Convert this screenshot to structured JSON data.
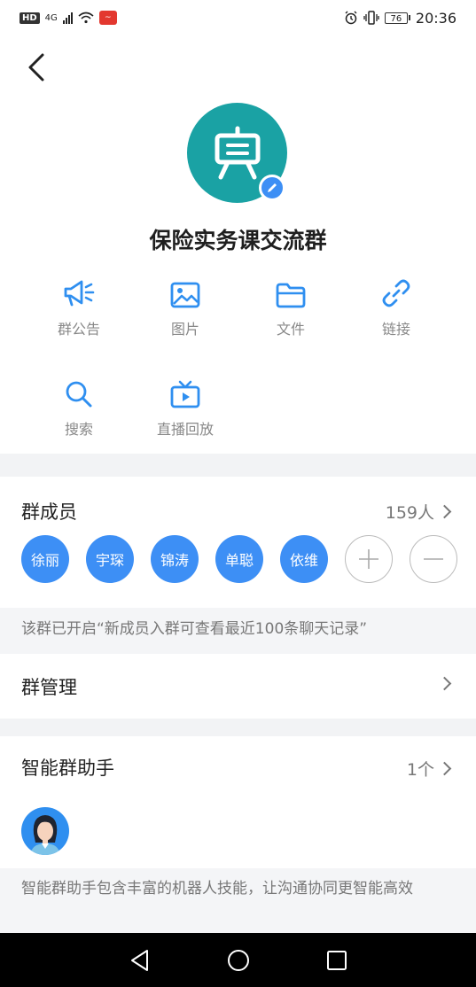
{
  "status_bar": {
    "hd": "HD",
    "network": "4G",
    "battery": "76",
    "time": "20:36"
  },
  "group": {
    "name": "保险实务课交流群"
  },
  "functions": [
    {
      "label": "群公告",
      "icon": "megaphone-icon"
    },
    {
      "label": "图片",
      "icon": "image-icon"
    },
    {
      "label": "文件",
      "icon": "folder-icon"
    },
    {
      "label": "链接",
      "icon": "link-icon"
    },
    {
      "label": "搜索",
      "icon": "search-icon"
    },
    {
      "label": "直播回放",
      "icon": "tv-playback-icon"
    }
  ],
  "members": {
    "title": "群成员",
    "count": "159人",
    "list": [
      "徐丽",
      "宇琛",
      "锦涛",
      "单聪",
      "依维"
    ]
  },
  "history_notice": "该群已开启“新成员入群可查看最近100条聊天记录”",
  "management": {
    "title": "群管理"
  },
  "assistant": {
    "title": "智能群助手",
    "count": "1个",
    "description": "智能群助手包含丰富的机器人技能，让沟通协同更智能高效"
  },
  "colors": {
    "accent": "#3d8ff5",
    "avatar_bg": "#1aa2a4",
    "muted_text": "#888888"
  }
}
